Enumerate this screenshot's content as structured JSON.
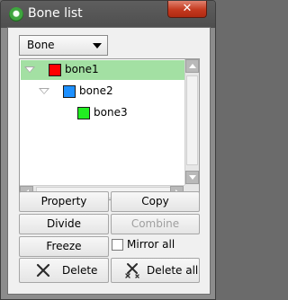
{
  "window": {
    "title": "Bone list",
    "close_glyph": "✕"
  },
  "combo": {
    "selected": "Bone",
    "options": [
      "Bone"
    ]
  },
  "tree": {
    "nodes": [
      {
        "label": "bone1",
        "color": "#ff0000",
        "selected": true,
        "expanded": true
      },
      {
        "label": "bone2",
        "color": "#1e90ff",
        "selected": false,
        "expanded": true
      },
      {
        "label": "bone3",
        "color": "#22ee22",
        "selected": false,
        "expanded": false
      }
    ],
    "selection_color": "#a3e0a3"
  },
  "buttons": {
    "property": "Property",
    "copy": "Copy",
    "divide": "Divide",
    "combine": "Combine",
    "freeze": "Freeze",
    "mirror_all": "Mirror all",
    "delete": "Delete",
    "delete_all": "Delete all"
  },
  "state": {
    "combine_enabled": false,
    "mirror_all_checked": false
  },
  "icons": {
    "app": "app-icon",
    "close": "close-icon",
    "delete": "x-icon",
    "delete_all": "multi-x-icon"
  }
}
